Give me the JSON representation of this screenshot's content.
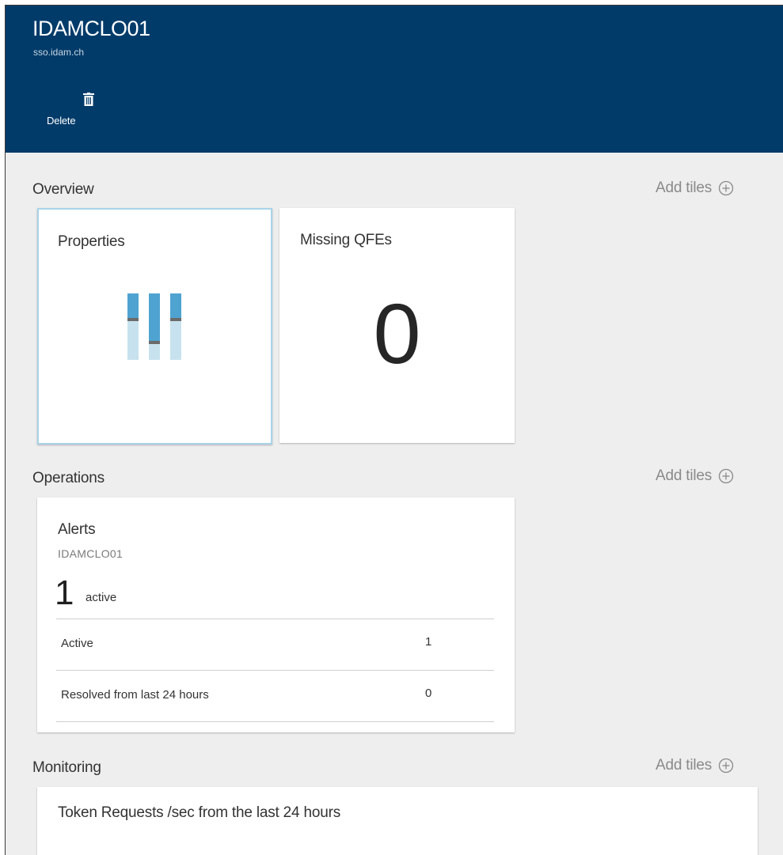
{
  "header": {
    "title": "IDAMCLO01",
    "subtitle": "sso.idam.ch",
    "delete_label": "Delete",
    "delete_icon": "trash-icon",
    "background": "#003b6a"
  },
  "overview": {
    "title": "Overview",
    "add_tiles_label": "Add tiles",
    "add_icon": "circle-plus-icon",
    "tiles": {
      "properties_title": "Properties",
      "properties_icon": "sliders-icon",
      "missing_qfes_title": "Missing QFEs",
      "missing_qfes_count": "0"
    }
  },
  "operations": {
    "title": "Operations",
    "add_tiles_label": "Add tiles",
    "alerts": {
      "title": "Alerts",
      "subtitle": "IDAMCLO01",
      "count": "1",
      "count_label": "active",
      "rows": [
        {
          "label": "Active",
          "value": "1"
        },
        {
          "label": "Resolved from last 24 hours",
          "value": "0"
        }
      ]
    }
  },
  "monitoring": {
    "title": "Monitoring",
    "add_tiles_label": "Add tiles",
    "chart_title": "Token Requests /sec from the last 24 hours"
  }
}
